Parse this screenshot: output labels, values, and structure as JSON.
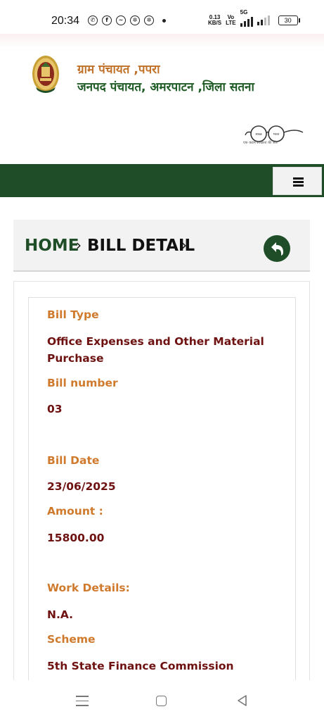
{
  "status_bar": {
    "time": "20:34",
    "app_icons": [
      "whatsapp-icon",
      "facebook-icon",
      "messenger-icon",
      "settings-icon",
      "settings-icon"
    ],
    "net_speed_value": "0.13",
    "net_speed_unit": "KB/S",
    "volte_top": "Vo",
    "volte_bottom": "LTE",
    "network": "5G",
    "battery": "30"
  },
  "header": {
    "panchayat_name": "ग्राम पंचायत ,पपरा",
    "janpad_name": "जनपद पंचायत, अमरपाटन ,जिला सतना",
    "swachh_tagline": "एक कदम स्वच्छता की ओर",
    "swachh_words": [
      "स्वच्छ",
      "भारत"
    ]
  },
  "nav": {
    "menu_icon": "hamburger-icon"
  },
  "breadcrumb": {
    "home": "HOME",
    "separator": "›",
    "current": "BILL DETAIL",
    "back_icon": "back-arrow-icon"
  },
  "bill": {
    "fields": [
      {
        "label": "Bill Type",
        "value": "Office Expenses and Other Material Purchase"
      },
      {
        "label": "Bill number",
        "value": "03"
      },
      {
        "label": "Bill Date",
        "value": "23/06/2025"
      },
      {
        "label": "Amount :",
        "value": "15800.00"
      },
      {
        "label": "Work Details:",
        "value": "N.A."
      },
      {
        "label": "Scheme",
        "value": "5th State Finance Commission"
      }
    ]
  },
  "colors": {
    "green": "#1e4d27",
    "orange_label": "#cf7a2d",
    "maroon_value": "#6e1111"
  }
}
